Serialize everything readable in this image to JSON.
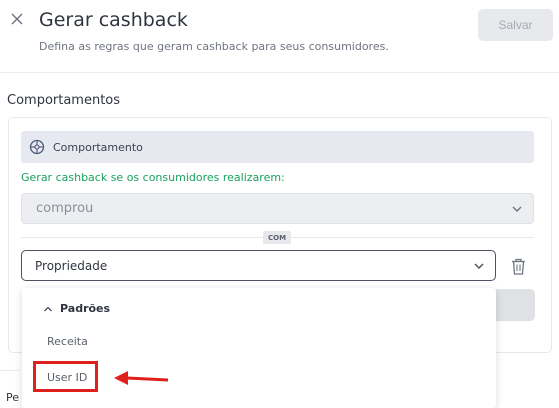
{
  "header": {
    "title": "Gerar cashback",
    "subtitle": "Defina as regras que geram cashback para seus consumidores.",
    "save_label": "Salvar"
  },
  "section": {
    "label": "Comportamentos"
  },
  "behavior": {
    "title": "Comportamento",
    "condition_label": "Gerar cashback se os consumidores realizarem:",
    "action_value": "comprou",
    "connector": "COM",
    "property_value": "Propriedade"
  },
  "dropdown": {
    "group_label": "Padrões",
    "options": [
      "Receita",
      "User ID"
    ]
  },
  "footer": {
    "partial_text": "Pe"
  },
  "colors": {
    "accent_green": "#1aa15e",
    "highlight_red": "#e0211b",
    "disabled_bg": "#eceef1"
  }
}
